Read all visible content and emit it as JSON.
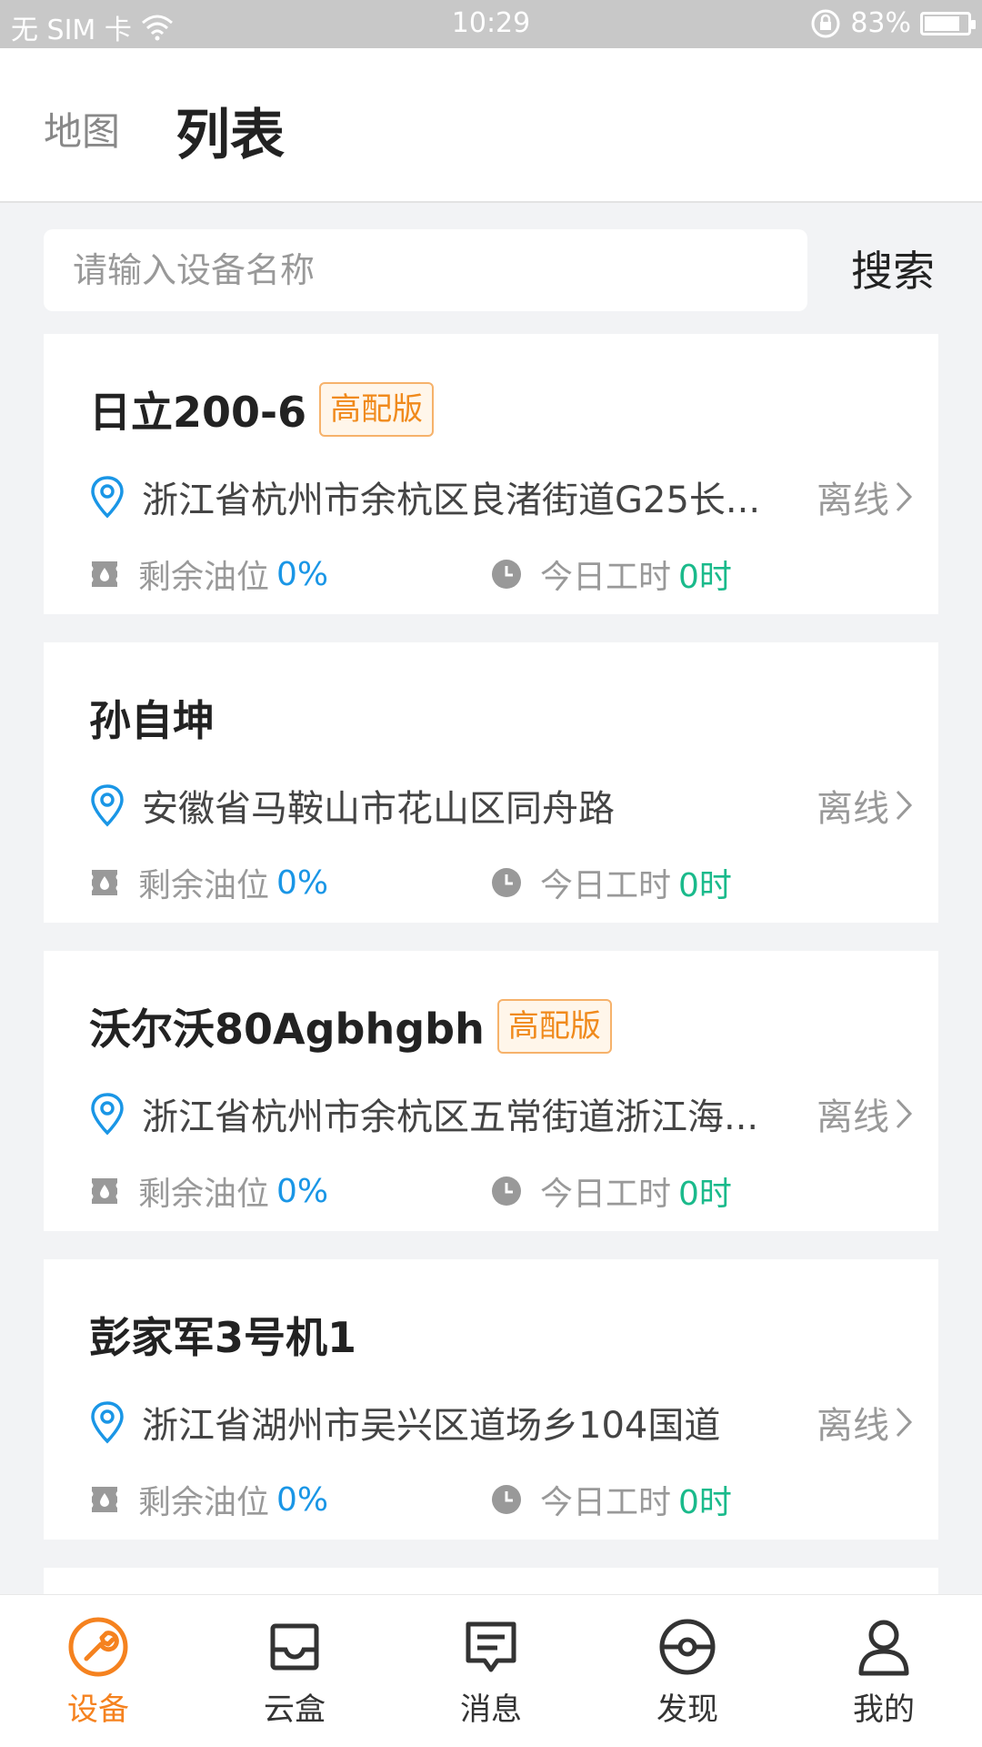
{
  "status_bar": {
    "carrier": "无 SIM 卡",
    "time": "10:29",
    "battery": "83%",
    "battery_level": 0.83
  },
  "header": {
    "tab_map": "地图",
    "tab_list": "列表"
  },
  "search": {
    "placeholder": "请输入设备名称",
    "value": "",
    "button": "搜索"
  },
  "devices": [
    {
      "name": "日立200-6",
      "badge": "高配版",
      "address": "浙江省杭州市余杭区良渚街道G25长...",
      "status": "离线",
      "fuel_label": "剩余油位",
      "fuel_value": "0%",
      "hours_label": "今日工时",
      "hours_value": "0时"
    },
    {
      "name": "孙自坤",
      "badge": "",
      "address": "安徽省马鞍山市花山区同舟路",
      "status": "离线",
      "fuel_label": "剩余油位",
      "fuel_value": "0%",
      "hours_label": "今日工时",
      "hours_value": "0时"
    },
    {
      "name": "沃尔沃80Agbhgbh",
      "badge": "高配版",
      "address": "浙江省杭州市余杭区五常街道浙江海...",
      "status": "离线",
      "fuel_label": "剩余油位",
      "fuel_value": "0%",
      "hours_label": "今日工时",
      "hours_value": "0时"
    },
    {
      "name": "彭家军3号机1",
      "badge": "",
      "address": "浙江省湖州市吴兴区道场乡104国道",
      "status": "离线",
      "fuel_label": "剩余油位",
      "fuel_value": "0%",
      "hours_label": "今日工时",
      "hours_value": "0时"
    }
  ],
  "nav": [
    {
      "label": "设备",
      "icon": "device-icon",
      "active": true
    },
    {
      "label": "云盒",
      "icon": "inbox-icon",
      "active": false
    },
    {
      "label": "消息",
      "icon": "message-icon",
      "active": false
    },
    {
      "label": "发现",
      "icon": "discover-icon",
      "active": false
    },
    {
      "label": "我的",
      "icon": "profile-icon",
      "active": false
    }
  ],
  "colors": {
    "accent": "#f5821f",
    "blue_value": "#1a96e6",
    "green_value": "#1aba8b",
    "badge": "#f08a1c",
    "pin": "#1a96e6"
  }
}
